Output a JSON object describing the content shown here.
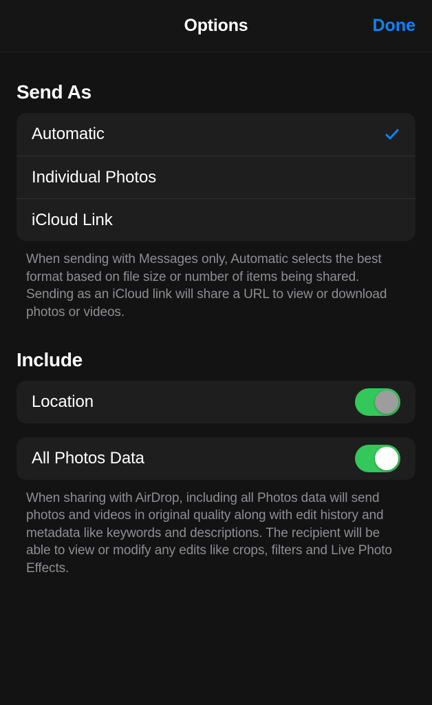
{
  "header": {
    "title": "Options",
    "done": "Done"
  },
  "sections": {
    "sendAs": {
      "header": "Send As",
      "options": [
        {
          "label": "Automatic",
          "selected": true
        },
        {
          "label": "Individual Photos",
          "selected": false
        },
        {
          "label": "iCloud Link",
          "selected": false
        }
      ],
      "footer": "When sending with Messages only, Automatic selects the best format based on file size or number of items being shared. Sending as an iCloud link will share a URL to view or download photos or videos."
    },
    "include": {
      "header": "Include",
      "items": [
        {
          "label": "Location",
          "on": true
        },
        {
          "label": "All Photos Data",
          "on": true
        }
      ],
      "footer": "When sharing with AirDrop, including all Photos data will send photos and videos in original quality along with edit history and metadata like keywords and descriptions. The recipient will be able to view or modify any edits like crops, filters and Live Photo Effects."
    }
  },
  "colors": {
    "accent": "#0a84ff",
    "toggleOn": "#34c759"
  }
}
